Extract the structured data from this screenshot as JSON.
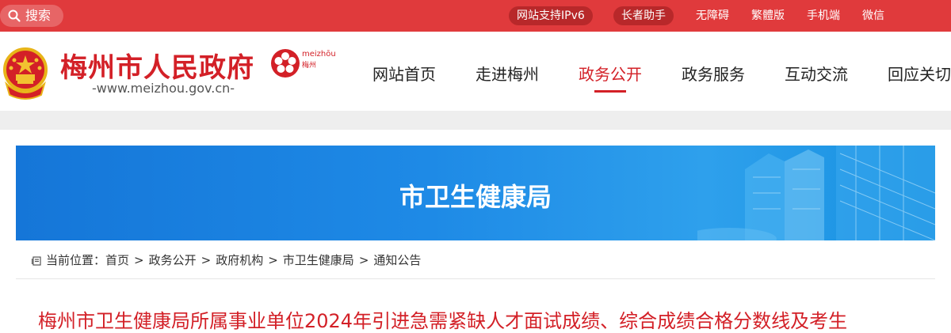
{
  "topbar": {
    "search_placeholder": "搜索",
    "links": [
      "网站支持IPv6",
      "长者助手",
      "无障碍",
      "繁體版",
      "手机端",
      "微信"
    ]
  },
  "header": {
    "site_name": "梅州市人民政府",
    "site_url": "-www.meizhou.gov.cn-",
    "logo_text_pinyin": "meizhōu",
    "logo_text_cn": "梅州",
    "nav": [
      "网站首页",
      "走进梅州",
      "政务公开",
      "政务服务",
      "互动交流",
      "回应关切"
    ],
    "active_nav": "政务公开"
  },
  "banner": {
    "title": "市卫生健康局"
  },
  "breadcrumb": {
    "label": "当前位置：",
    "items": [
      "首页",
      "政务公开",
      "政府机构",
      "市卫生健康局",
      "通知公告"
    ]
  },
  "article": {
    "title": "梅州市卫生健康局所属事业单位2024年引进急需紧缺人才面试成绩、综合成绩合格分数线及考生"
  },
  "colors": {
    "brand_red": "#e03a3c",
    "title_red": "#d32027",
    "banner_blue": "#1e8ae6"
  }
}
